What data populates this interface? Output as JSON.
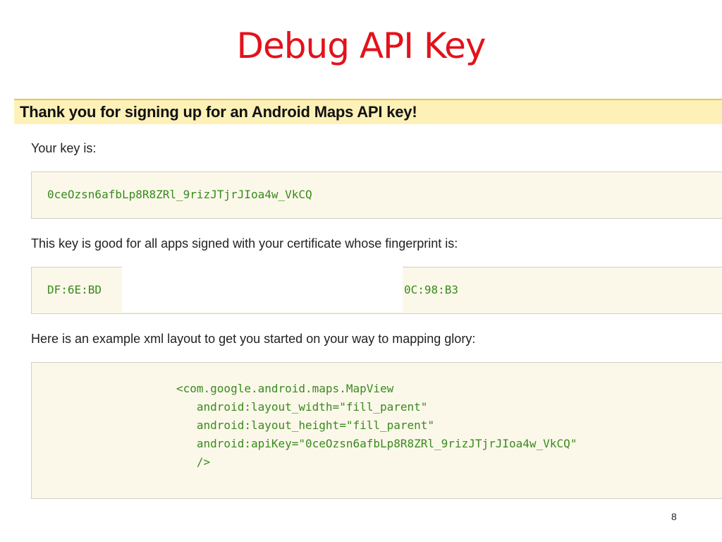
{
  "slide": {
    "title": "Debug API Key",
    "page_number": "8"
  },
  "screenshot": {
    "header": "Thank you for signing up for an Android Maps API key!",
    "key_label": "Your key is:",
    "key_value": "0ceOzsn6afbLp8R8ZRl_9rizJTjrJIoa4w_VkCQ",
    "fingerprint_label": "This key is good for all apps signed with your certificate whose fingerprint is:",
    "fingerprint_start": "DF:6E:BD",
    "fingerprint_end": "0C:98:B3",
    "example_label": "Here is an example xml layout to get you started on your way to mapping glory:",
    "code_lines": [
      "<com.google.android.maps.MapView",
      "   android:layout_width=\"fill_parent\"",
      "   android:layout_height=\"fill_parent\"",
      "   android:apiKey=\"0ceOzsn6afbLp8R8ZRl_9rizJTjrJIoa4w_VkCQ\"",
      "   />"
    ]
  },
  "colors": {
    "title": "#e3121b",
    "header_bg": "#fdf1b8",
    "box_bg": "#fbf8ea",
    "code_text": "#3a8a1e"
  }
}
